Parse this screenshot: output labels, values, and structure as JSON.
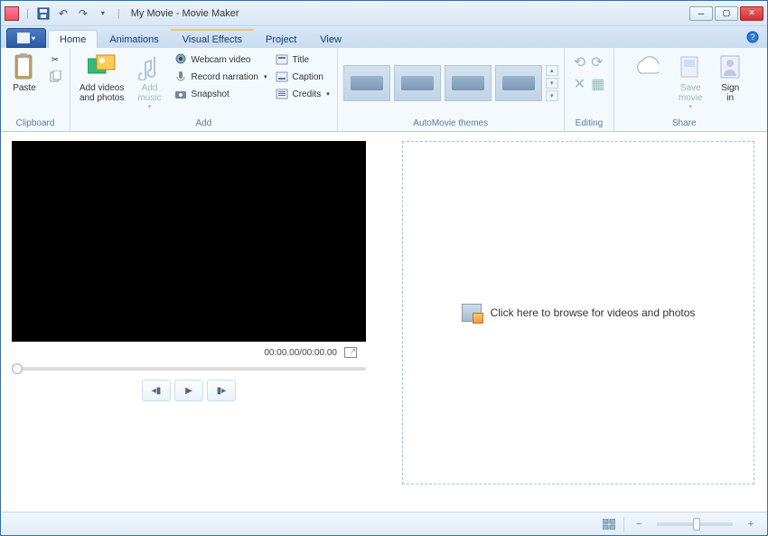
{
  "window": {
    "title": "My Movie - Movie Maker"
  },
  "tabs": {
    "home": "Home",
    "animations": "Animations",
    "visual_effects": "Visual Effects",
    "project": "Project",
    "view": "View"
  },
  "ribbon": {
    "clipboard": {
      "label": "Clipboard",
      "paste": "Paste"
    },
    "add": {
      "label": "Add",
      "add_videos": "Add videos\nand photos",
      "add_music": "Add\nmusic",
      "webcam": "Webcam video",
      "narration": "Record narration",
      "snapshot": "Snapshot",
      "title": "Title",
      "caption": "Caption",
      "credits": "Credits"
    },
    "themes": {
      "label": "AutoMovie themes"
    },
    "editing": {
      "label": "Editing"
    },
    "share": {
      "label": "Share",
      "save_movie": "Save\nmovie",
      "sign_in": "Sign\nin"
    }
  },
  "preview": {
    "time": "00:00.00/00:00.00"
  },
  "timeline": {
    "drop_hint": "Click here to browse for videos and photos"
  }
}
